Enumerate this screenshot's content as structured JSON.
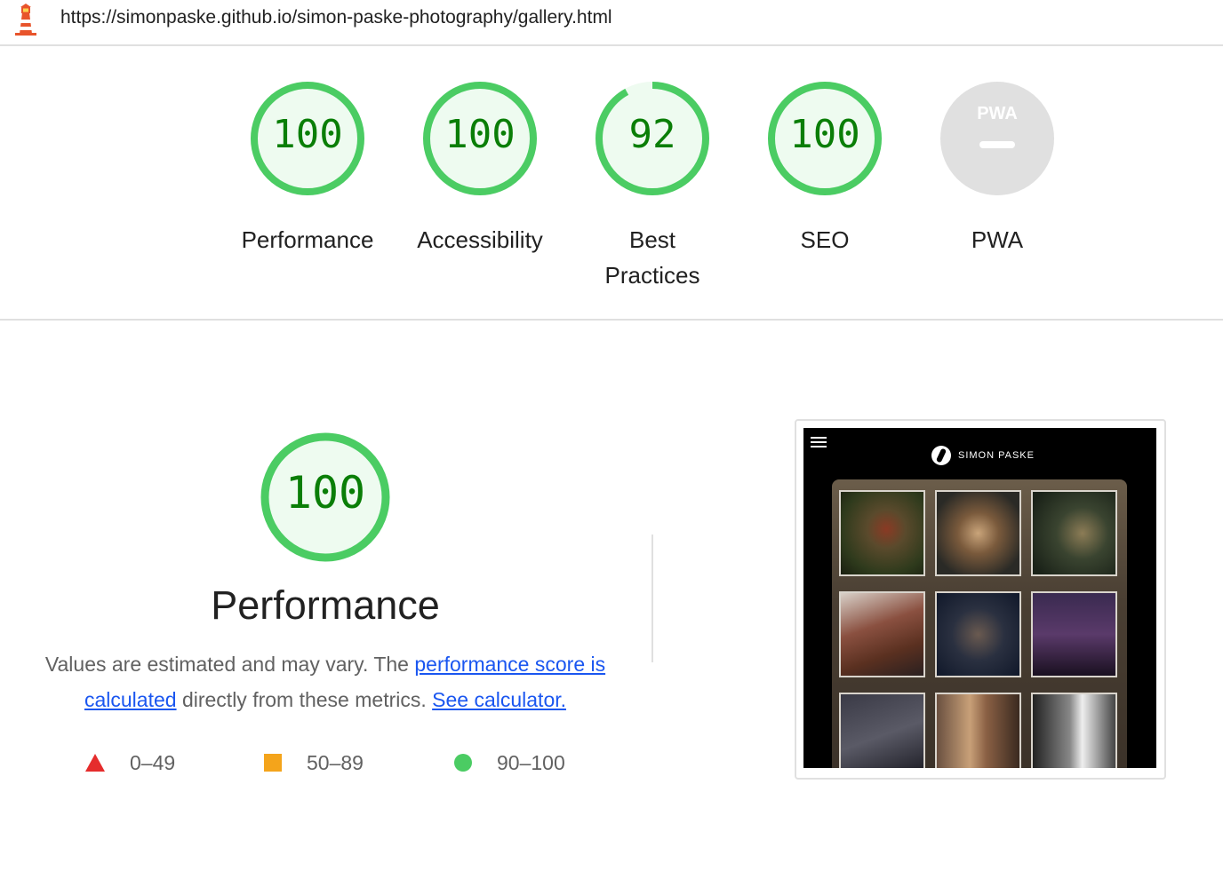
{
  "url": "https://simonpaske.github.io/simon-paske-photography/gallery.html",
  "colors": {
    "pass_green": "#0cce6b",
    "pass_stroke": "#4bcc63",
    "pass_fill": "#eefbf0",
    "pass_text": "#0a7e07",
    "fail_red": "#e52c2c",
    "average_orange": "#f4a41b",
    "link_blue": "#1a56f0"
  },
  "gauges": [
    {
      "score": "100",
      "label": "Performance",
      "value": 100
    },
    {
      "score": "100",
      "label": "Accessibility",
      "value": 100
    },
    {
      "score": "92",
      "label": "Best Practices",
      "value": 92
    },
    {
      "score": "100",
      "label": "SEO",
      "value": 100
    },
    {
      "score": "",
      "label": "PWA",
      "badge_text": "PWA"
    }
  ],
  "performance": {
    "score": "100",
    "title": "Performance",
    "desc_prefix": "Values are estimated and may vary. The ",
    "desc_link1": "performance score is calculated",
    "desc_middle": " directly from these metrics. ",
    "desc_link2": "See calculator.",
    "legend": [
      {
        "shape": "triangle",
        "range": "0–49"
      },
      {
        "shape": "square",
        "range": "50–89"
      },
      {
        "shape": "circle",
        "range": "90–100"
      }
    ]
  },
  "screenshot": {
    "brand": "SIMON PASKE",
    "icons": [
      "hamburger-icon",
      "brand-logo-icon"
    ]
  }
}
